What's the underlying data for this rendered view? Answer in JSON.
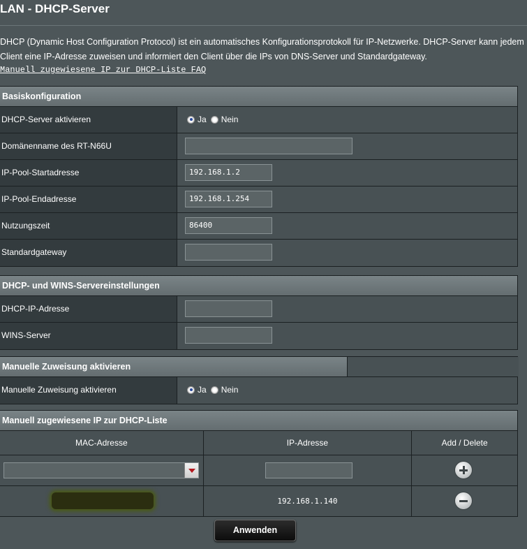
{
  "page": {
    "title": "LAN - DHCP-Server",
    "description": "DHCP (Dynamic Host Configuration Protocol) ist ein automatisches Konfigurationsprotokoll für IP-Netzwerke. DHCP-Server kann jedem Client eine IP-Adresse zuweisen und informiert den Client über die IPs von DNS-Server und Standardgateway.",
    "faq_link": "Manuell zugewiesene IP zur DHCP-Liste FAQ"
  },
  "basic": {
    "header": "Basiskonfiguration",
    "dhcp_enable_label": "DHCP-Server aktivieren",
    "yes": "Ja",
    "no": "Nein",
    "domain_label": "Domänenname des RT-N66U",
    "domain_value": "",
    "pool_start_label": "IP-Pool-Startadresse",
    "pool_start_value": "192.168.1.2",
    "pool_end_label": "IP-Pool-Endadresse",
    "pool_end_value": "192.168.1.254",
    "lease_label": "Nutzungszeit",
    "lease_value": "86400",
    "gateway_label": "Standardgateway",
    "gateway_value": ""
  },
  "wins": {
    "header": "DHCP- und WINS-Servereinstellungen",
    "dns_label": "DHCP-IP-Adresse",
    "dns_value": "",
    "wins_label": "WINS-Server",
    "wins_value": ""
  },
  "manual": {
    "header": "Manuelle Zuweisung aktivieren",
    "enable_label": "Manuelle Zuweisung aktivieren",
    "yes": "Ja",
    "no": "Nein"
  },
  "list": {
    "header": "Manuell zugewiesene IP zur DHCP-Liste",
    "col_mac": "MAC-Adresse",
    "col_ip": "IP-Adresse",
    "col_action": "Add / Delete",
    "entries": [
      {
        "ip": "192.168.1.140"
      }
    ]
  },
  "apply_label": "Anwenden",
  "icons": [
    "plus-circle-icon",
    "minus-circle-icon",
    "dropdown-arrow-icon"
  ]
}
